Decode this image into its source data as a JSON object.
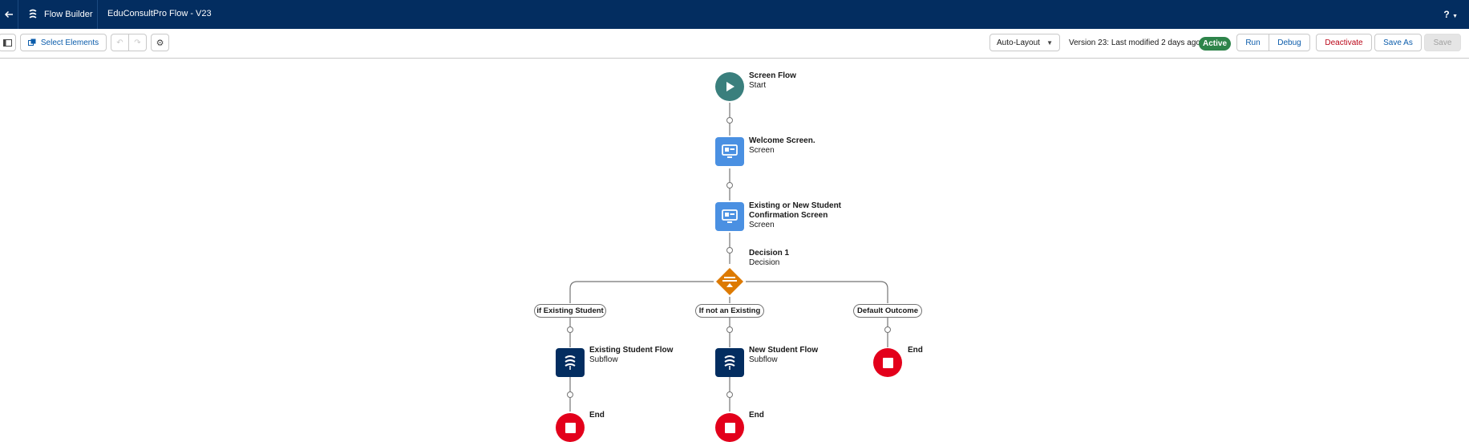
{
  "header": {
    "app_name": "Flow Builder",
    "flow_name": "EduConsultPro Flow - V23",
    "help_label": "?"
  },
  "toolbar": {
    "select_elements_label": "Select Elements",
    "layout_select_value": "Auto-Layout",
    "version_text": "Version 23: Last modified 2 days ago",
    "status_badge": "Active",
    "run_label": "Run",
    "debug_label": "Debug",
    "deactivate_label": "Deactivate",
    "save_as_label": "Save As",
    "save_label": "Save"
  },
  "flow": {
    "start": {
      "title": "Screen Flow",
      "subtitle": "Start"
    },
    "welcome": {
      "title": "Welcome Screen.",
      "subtitle": "Screen"
    },
    "confirm": {
      "title_line1": "Existing or New Student",
      "title_line2": "Confirmation Screen",
      "subtitle": "Screen"
    },
    "decision": {
      "title": "Decision 1",
      "subtitle": "Decision"
    },
    "outcomes": {
      "existing": "if Existing Student",
      "new": "If not an Existing",
      "default": "Default Outcome"
    },
    "existing_subflow": {
      "title": "Existing Student Flow",
      "subtitle": "Subflow"
    },
    "new_subflow": {
      "title": "New Student Flow",
      "subtitle": "Subflow"
    },
    "end_label": "End"
  },
  "colors": {
    "header_bg": "#032d60",
    "start_icon": "#3a7f7d",
    "screen_icon": "#4a90e2",
    "decision_icon": "#dd7a01",
    "subflow_icon": "#032d60",
    "end_icon": "#e3001b",
    "active_badge": "#2e844a"
  },
  "icons": {
    "back": "arrow-left-icon",
    "app": "flow-icon",
    "toggle_panel": "panel-toggle-icon",
    "select": "select-elements-icon",
    "undo": "undo-icon",
    "redo": "redo-icon",
    "settings": "gear-icon",
    "dropdown": "chevron-down-icon"
  }
}
